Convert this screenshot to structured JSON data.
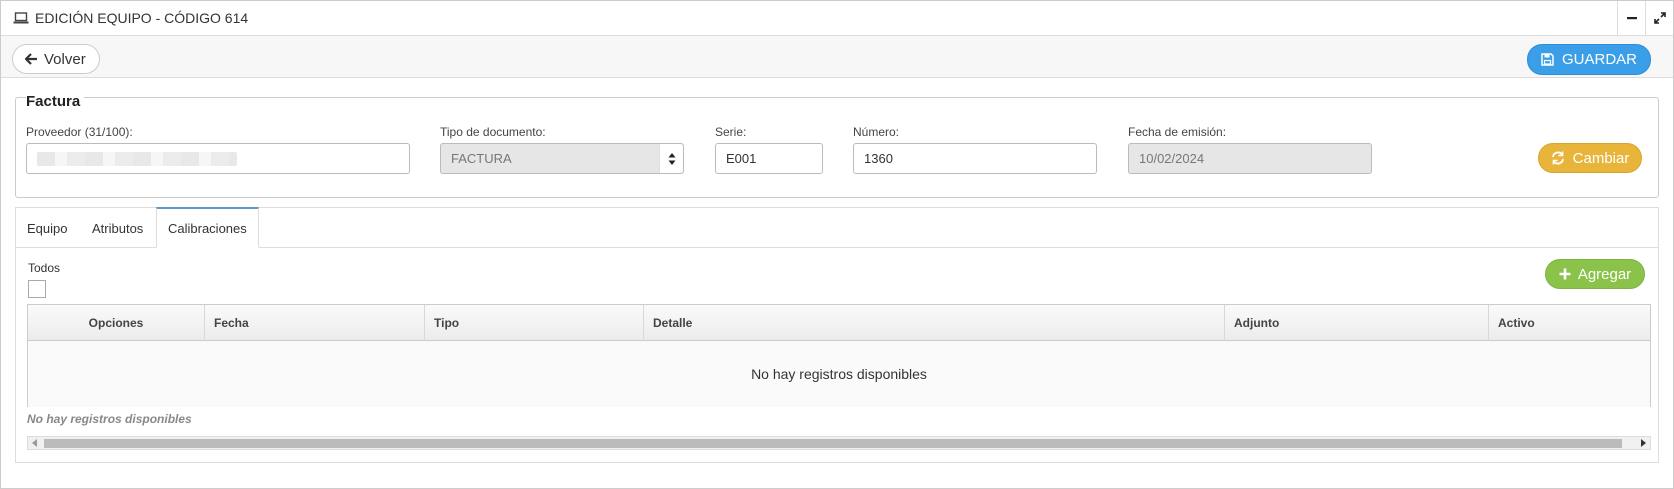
{
  "window": {
    "title": "EDICIÓN EQUIPO - CÓDIGO 614"
  },
  "toolbar": {
    "back_label": "Volver",
    "save_label": "GUARDAR"
  },
  "factura": {
    "legend": "Factura",
    "proveedor_label": "Proveedor (31/100):",
    "proveedor_value": "",
    "tipo_doc_label": "Tipo de documento:",
    "tipo_doc_value": "FACTURA",
    "serie_label": "Serie:",
    "serie_value": "E001",
    "numero_label": "Número:",
    "numero_value": "1360",
    "fecha_label": "Fecha de emisión:",
    "fecha_value": "10/02/2024",
    "cambiar_label": "Cambiar"
  },
  "tabs": [
    {
      "label": "Equipo",
      "active": false
    },
    {
      "label": "Atributos",
      "active": false
    },
    {
      "label": "Calibraciones",
      "active": true
    }
  ],
  "calibraciones": {
    "todos_label": "Todos",
    "agregar_label": "Agregar",
    "columns": [
      "Opciones",
      "Fecha",
      "Tipo",
      "Detalle",
      "Adjunto",
      "Activo"
    ],
    "empty_message": "No hay registros disponibles",
    "footer_message": "No hay registros disponibles"
  },
  "colors": {
    "save_button": "#3a9ee8",
    "cambiar_button": "#e8b53a",
    "agregar_button": "#8bc34a"
  },
  "icons": [
    "laptop-icon",
    "minimize-icon",
    "expand-icon",
    "arrow-left-icon",
    "floppy-disk-icon",
    "refresh-icon",
    "sort-icon",
    "plus-icon"
  ]
}
